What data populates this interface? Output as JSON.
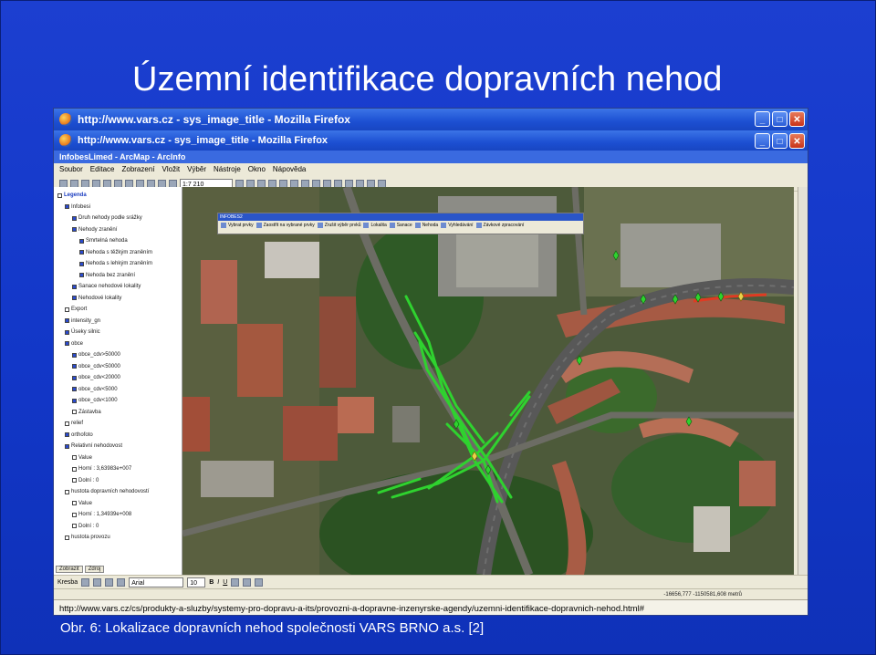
{
  "slide": {
    "title": "Územní identifikace dopravních nehod",
    "caption": "Obr. 6: Lokalizace dopravních nehod společnosti VARS BRNO a.s. [2]"
  },
  "browser": {
    "outer_title": "http://www.vars.cz - sys_image_title - Mozilla Firefox",
    "inner_title": "http://www.vars.cz - sys_image_title - Mozilla Firefox",
    "url": "http://www.vars.cz/cs/produkty-a-sluzby/systemy-pro-dopravu-a-its/provozni-a-dopravne-inzenyrske-agendy/uzemni-identifikace-dopravnich-nehod.html#"
  },
  "arcmap": {
    "title": "InfobesLimed - ArcMap - ArcInfo",
    "menu": [
      "Soubor",
      "Editace",
      "Zobrazení",
      "Vložit",
      "Výběr",
      "Nástroje",
      "Okno",
      "Nápověda"
    ],
    "scale": "1:7 210",
    "toc": [
      {
        "label": "Legenda",
        "checked": false,
        "level": 0
      },
      {
        "label": "Infobesi",
        "checked": true,
        "level": 1
      },
      {
        "label": "Druh nehody podle srážky",
        "checked": true,
        "level": 2
      },
      {
        "label": "Nehody zranění",
        "checked": true,
        "level": 2
      },
      {
        "label": "Smrtelná nehoda",
        "checked": true,
        "level": 3
      },
      {
        "label": "Nehoda s těžkým zraněním",
        "checked": true,
        "level": 3
      },
      {
        "label": "Nehoda s lehkým zraněním",
        "checked": true,
        "level": 3
      },
      {
        "label": "Nehoda bez zranění",
        "checked": true,
        "level": 3
      },
      {
        "label": "Sanace nehodové lokality",
        "checked": true,
        "level": 2
      },
      {
        "label": "Nehodové lokality",
        "checked": true,
        "level": 2
      },
      {
        "label": "Export",
        "checked": false,
        "level": 1
      },
      {
        "label": "intensity_gn",
        "checked": true,
        "level": 1
      },
      {
        "label": "Úseky silnic",
        "checked": true,
        "level": 1
      },
      {
        "label": "obce",
        "checked": true,
        "level": 1
      },
      {
        "label": "obce_cdv>50000",
        "checked": true,
        "level": 2
      },
      {
        "label": "obce_cdv<50000",
        "checked": true,
        "level": 2
      },
      {
        "label": "obce_cdv<20000",
        "checked": true,
        "level": 2
      },
      {
        "label": "obce_cdv<5000",
        "checked": true,
        "level": 2
      },
      {
        "label": "obce_cdv<1000",
        "checked": true,
        "level": 2
      },
      {
        "label": "Zástavba",
        "checked": false,
        "level": 2
      },
      {
        "label": "relief",
        "checked": false,
        "level": 1
      },
      {
        "label": "orthofoto",
        "checked": true,
        "level": 1
      },
      {
        "label": "Relativní nehodovost",
        "checked": true,
        "level": 1
      },
      {
        "label": "Value",
        "checked": false,
        "level": 2
      },
      {
        "label": "Horní : 3,63983e+007",
        "checked": false,
        "level": 2
      },
      {
        "label": "Dolní : 0",
        "checked": false,
        "level": 2
      },
      {
        "label": "hustota dopravních nehodovostí",
        "checked": false,
        "level": 1
      },
      {
        "label": "Value",
        "checked": false,
        "level": 2
      },
      {
        "label": "Horní : 1,34939e+008",
        "checked": false,
        "level": 2
      },
      {
        "label": "Dolní : 0",
        "checked": false,
        "level": 2
      },
      {
        "label": "hustota provozu",
        "checked": false,
        "level": 1
      }
    ],
    "toc_tabs": [
      "Zobrazit",
      "Zdroj"
    ],
    "infobes": {
      "title": "INFOBES2",
      "buttons": [
        "Vybrat prvky",
        "Zaostřit na vybrané prvky",
        "Zrušit výběr prvků",
        "Lokalita",
        "Sanace",
        "Nehoda",
        "Vyhledávání",
        "Závkové zpracování"
      ]
    },
    "drawbar": {
      "label": "Kresba",
      "font": "Arial",
      "size": "10",
      "bold": "B",
      "italic": "I",
      "underline": "U"
    },
    "status": "-16656,777  -1150581,608 metrů",
    "colors": {
      "accident_green": "#2fd22f",
      "accident_red": "#e03a22",
      "symbol_yellow": "#e8d24a"
    }
  }
}
